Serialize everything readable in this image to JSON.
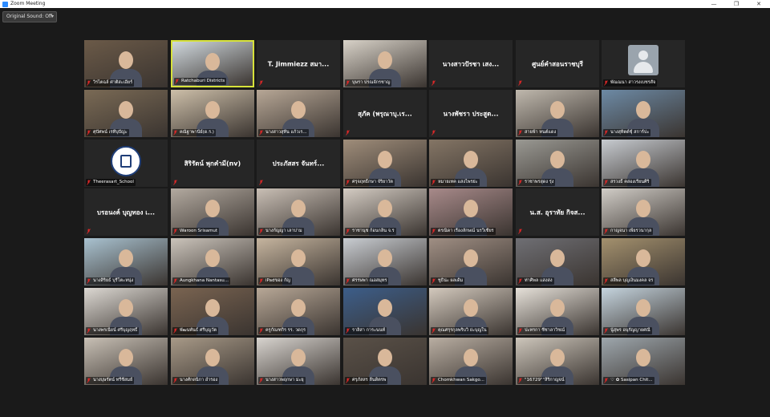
{
  "window": {
    "title": "Zoom Meeting",
    "minimize": "—",
    "restore": "❐",
    "close": "✕"
  },
  "audio": {
    "original_sound": "Original Sound: Off"
  },
  "icons": {
    "mic_muted": "mic-muted-icon",
    "app": "zoom-app-icon",
    "avatar": "avatar-icon"
  },
  "colors": {
    "active_speaker": "#d7e23a",
    "mic_muted": "#e02828",
    "tile_bg": "#262626"
  },
  "participants": [
    {
      "label": "วิรไตฉล์ ศาติสะเอียร์",
      "name_center": "",
      "video": "#6b5a48"
    },
    {
      "label": "Ratchaburi Districts",
      "name_center": "",
      "video": "#cfd7dc",
      "active": true
    },
    {
      "label": "",
      "name_center": "T. Jimmiezz สมา...",
      "video": ""
    },
    {
      "label": "บุษรา ปรณจักรชาญ",
      "name_center": "",
      "video": "#d8d2c8"
    },
    {
      "label": "",
      "name_center": "นางสาวปัรชา เสง...",
      "video": ""
    },
    {
      "label": "",
      "name_center": "ศูนย์คำสอนราชบุรี",
      "video": ""
    },
    {
      "label": "พัณณนา สาวรงเบชรสัจ",
      "name_center": "",
      "video": "avatar"
    },
    {
      "label": "ศุปัศพน์ เรทีบุปัญ่ะ",
      "name_center": "",
      "video": "#7a6a55"
    },
    {
      "label": "คณิฐาพานีย์(ด.ร.)",
      "name_center": "",
      "video": "#cdbfa9"
    },
    {
      "label": "นางสาวสุทีน แก้วเร...",
      "name_center": "",
      "video": "#b7a796"
    },
    {
      "label": "",
      "name_center": "สุภัค (พรุณาบุ.เร...",
      "video": ""
    },
    {
      "label": "",
      "name_center": "นางพัชรา ประสูต...",
      "video": ""
    },
    {
      "label": "สายฟ้า ทนต์แดง",
      "name_center": "",
      "video": "#bfb8ad"
    },
    {
      "label": "นางสุทิตต์ชุ์ สการ์ปะ",
      "name_center": "",
      "video": "#6d8aa5"
    },
    {
      "label": "Theerasart_School",
      "name_center": "",
      "video": "logo"
    },
    {
      "label": "",
      "name_center": "สิริรัตน์ พุกคำมี(nv)",
      "video": ""
    },
    {
      "label": "",
      "name_center": "ประภัสสร จันทร์...",
      "video": ""
    },
    {
      "label": "ศรุจฤทธิ์กษา จัริยาวัต",
      "name_center": "",
      "video": "#9f8d7a"
    },
    {
      "label": "หมายเทค แสงไพรย่ะ",
      "name_center": "",
      "video": "#847565"
    },
    {
      "label": "ราชาพรสุดง รุ่ง",
      "name_center": "",
      "video": "#9a9993"
    },
    {
      "label": "สรวงธิ์ คล่องเรียนศิริ",
      "name_center": "",
      "video": "#c7cbd0"
    },
    {
      "label": "",
      "name_center": "บรอนงค์ บุญทอง เ...",
      "video": ""
    },
    {
      "label": "Waroon Srisamut",
      "name_center": "",
      "video": "#b3aaa0"
    },
    {
      "label": "นางกัญญา เลาบ่าม",
      "name_center": "",
      "video": "#c9bfb5"
    },
    {
      "label": "ราชานุช ก้อนกลิ่น จ.ร",
      "name_center": "",
      "video": "#d4ccc3"
    },
    {
      "label": "ตรณิดา เรืองลักษณ์ นรวิเชียร",
      "name_center": "",
      "video": "#a88a8a"
    },
    {
      "label": "",
      "name_center": "น.ส. อุราทัย กิจส...",
      "video": ""
    },
    {
      "label": "กาญจนา เพียรวนากุล",
      "name_center": "",
      "video": "#d1cdc7"
    },
    {
      "label": "นางสิริยธ์ บุรีโตะหนุ่ง",
      "name_center": "",
      "video": "#a9c2d0"
    },
    {
      "label": "Aungkhana Nantasu...",
      "name_center": "",
      "video": "#cbc4bb"
    },
    {
      "label": "iPadของ กัญ",
      "name_center": "",
      "video": "#c6b59f"
    },
    {
      "label": "ศรรษพา ณอสมุทร",
      "name_center": "",
      "video": "#c9cdd2"
    },
    {
      "label": "ชูธิน่ะ ผลเดิม",
      "name_center": "",
      "video": "#a08f84"
    },
    {
      "label": "ท่าศิพล แสงสง",
      "name_center": "",
      "video": "#6f6f74"
    },
    {
      "label": "สลีพล บุญเงินมงคล จร",
      "name_center": "",
      "video": "#a4916e"
    },
    {
      "label": "นางพรเนียน์ ศรีบุญฤทธิ์",
      "name_center": "",
      "video": "#dcd8d2"
    },
    {
      "label": "พัฒนพันธ์ ศรีบุญวัต",
      "name_center": "",
      "video": "#7a6451"
    },
    {
      "label": "ครูกัณฑกิร รร. วดกุร",
      "name_center": "",
      "video": "#b8a897"
    },
    {
      "label": "ราลิสา การะนนท์",
      "name_center": "",
      "video": "#3c5e8a"
    },
    {
      "label": "คุณศรุรกุลพริบวิ ย่ะบุญใน",
      "name_center": "",
      "video": "#d3c9bd"
    },
    {
      "label": "ปะทรกา ชีชาลาวิชณ์",
      "name_center": "",
      "video": "#e6e1d9"
    },
    {
      "label": "นู้สุพร อนุรัญญายศณี",
      "name_center": "",
      "video": "#c5d4de"
    },
    {
      "label": "นางบุษรัตน์ ทรีชีสมย์",
      "name_center": "",
      "video": "#c8c0b5"
    },
    {
      "label": "นางศักดนิกา อำรอง",
      "name_center": "",
      "video": "#a89a88"
    },
    {
      "label": "นางสาวพฤกษา ม่ะยุ",
      "name_center": "",
      "video": "#d8d4cf"
    },
    {
      "label": "ศรุภัสสร ลีนดิตรพ",
      "name_center": "",
      "video": "#5a5148"
    },
    {
      "label": "Chomkhwan Sakgo...",
      "name_center": "",
      "video": "#b9aea2"
    },
    {
      "label": "\"16729\"\"สิริกาญจน์",
      "name_center": "",
      "video": "#cdc6bb"
    },
    {
      "label": "♡ ✿ Sasipan Chit...",
      "name_center": "",
      "video": "#9ea7ad"
    }
  ]
}
